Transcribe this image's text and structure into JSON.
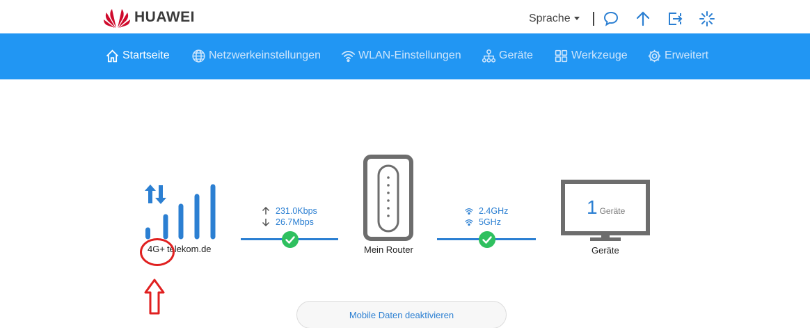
{
  "header": {
    "brand": "HUAWEI",
    "language_label": "Sprache",
    "icons": [
      "chat-icon",
      "upload-icon",
      "logout-icon",
      "loading-icon"
    ]
  },
  "nav": {
    "items": [
      {
        "label": "Startseite",
        "icon": "home-icon",
        "active": true
      },
      {
        "label": "Netzwerkeinstellungen",
        "icon": "globe-icon",
        "active": false
      },
      {
        "label": "WLAN-Einstellungen",
        "icon": "wifi-icon",
        "active": false
      },
      {
        "label": "Geräte",
        "icon": "devices-icon",
        "active": false
      },
      {
        "label": "Werkzeuge",
        "icon": "tools-icon",
        "active": false
      },
      {
        "label": "Erweitert",
        "icon": "gear-icon",
        "active": false
      }
    ]
  },
  "main": {
    "network_type": "4G+",
    "provider": "telekom.de",
    "upload_speed": "231.0Kbps",
    "download_speed": "26.7Mbps",
    "router_label": "Mein Router",
    "band_24": "2.4GHz",
    "band_5": "5GHz",
    "device_count": "1",
    "device_count_unit": "Geräte",
    "devices_label": "Geräte",
    "mobile_data_button": "Mobile Daten deaktivieren"
  },
  "colors": {
    "nav_bg": "#2196f3",
    "accent": "#2b7fd2",
    "status_ok": "#2fc05f",
    "annotation": "#e02020",
    "device_gray": "#6d6d6d"
  }
}
